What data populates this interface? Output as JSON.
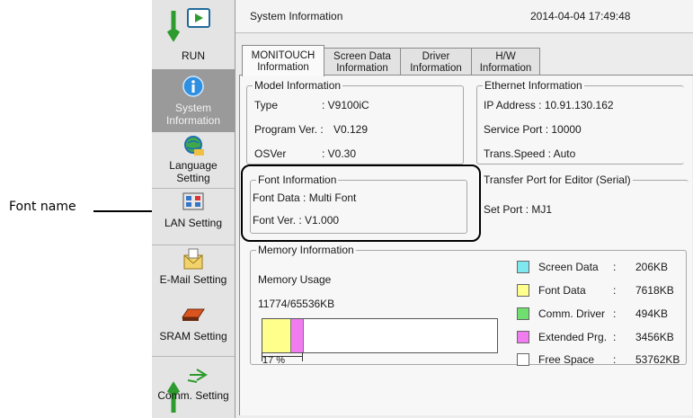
{
  "annotation": {
    "label": "Font name"
  },
  "sidebar": {
    "items": [
      {
        "label": "RUN",
        "icon": "run-icon"
      },
      {
        "label": "System Information",
        "icon": "info-icon"
      },
      {
        "label": "Language Setting",
        "icon": "globe-icon"
      },
      {
        "label": "LAN Setting",
        "icon": "network-icon"
      },
      {
        "label": "E-Mail Setting",
        "icon": "mail-icon"
      },
      {
        "label": "SRAM Setting",
        "icon": "sram-icon"
      },
      {
        "label": "Comm. Setting",
        "icon": "comm-icon"
      }
    ]
  },
  "header": {
    "title": "System Information",
    "datetime": "2014-04-04 17:49:48"
  },
  "tabs": [
    {
      "line1": "MONITOUCH",
      "line2": "Information"
    },
    {
      "line1": "Screen Data",
      "line2": "Information"
    },
    {
      "line1": "Driver",
      "line2": "Information"
    },
    {
      "line1": "H/W",
      "line2": "Information"
    }
  ],
  "model": {
    "legend": "Model Information",
    "type_label": "Type",
    "type_value": ":  V9100iC",
    "prog_label": "Program Ver. :",
    "prog_value": "V0.129",
    "os_label": "OSVer",
    "os_value": ":  V0.30"
  },
  "ethernet": {
    "legend": "Ethernet Information",
    "ip": "IP Address   :  10.91.130.162",
    "port": "Service Port :  10000",
    "speed": "Trans.Speed :  Auto"
  },
  "font": {
    "legend": "Font Information",
    "data": "Font Data :  Multi Font",
    "ver": "Font Ver.  :  V1.000"
  },
  "transfer": {
    "legend": "Transfer Port for Editor (Serial)",
    "set_port": "Set Port :  MJ1"
  },
  "memory": {
    "legend": "Memory Information",
    "usage_label": "Memory Usage",
    "usage_value": "11774/65536KB",
    "percent_label": "17 %",
    "used_fraction": 0.18,
    "legend_items": [
      {
        "name": "Screen Data",
        "value": "206KB",
        "color": "#7fe8ef"
      },
      {
        "name": "Font Data",
        "value": "7618KB",
        "color": "#ffff8c"
      },
      {
        "name": "Comm. Driver",
        "value": "494KB",
        "color": "#6fe06f"
      },
      {
        "name": "Extended Prg.",
        "value": "3456KB",
        "color": "#f07cf0"
      },
      {
        "name": "Free Space",
        "value": "53762KB",
        "color": "#ffffff"
      }
    ]
  }
}
